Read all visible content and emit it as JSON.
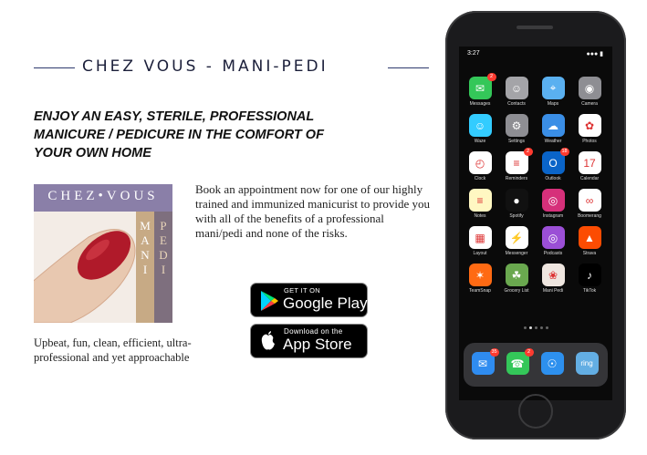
{
  "header": {
    "title": "CHEZ VOUS - MANI-PEDI"
  },
  "headline": "ENJOY AN EASY, STERILE, PROFESSIONAL MANICURE  / PEDICURE IN THE COMFORT OF YOUR OWN HOME",
  "description": "Book an appointment now for one of our highly trained and immunized manicurist to provide you with all of the benefits of a professional mani/pedi and none of the risks.",
  "tagline": "Upbeat, fun, clean, efficient, ultra-professional and yet approachable",
  "logo": {
    "top": "CHEZ•VOUS",
    "mani": [
      "M",
      "A",
      "N",
      "I"
    ],
    "pedi": [
      "P",
      "E",
      "D",
      "I"
    ]
  },
  "stores": {
    "google": {
      "small": "GET IT ON",
      "big": "Google Play"
    },
    "apple": {
      "small": "Download on the",
      "big": "App Store"
    }
  },
  "phone": {
    "time": "3:27",
    "apps": [
      {
        "label": "Messages",
        "color": "#34c759",
        "glyph": "✉",
        "badge": "2"
      },
      {
        "label": "Contacts",
        "color": "#a4a4a8",
        "glyph": "☺",
        "badge": ""
      },
      {
        "label": "Maps",
        "color": "#5ab0f0",
        "glyph": "⌖",
        "badge": ""
      },
      {
        "label": "Camera",
        "color": "#8e8e93",
        "glyph": "◉",
        "badge": ""
      },
      {
        "label": "Waze",
        "color": "#33ccff",
        "glyph": "☺",
        "badge": ""
      },
      {
        "label": "Settings",
        "color": "#8e8e93",
        "glyph": "⚙",
        "badge": ""
      },
      {
        "label": "Weather",
        "color": "#3a8ee6",
        "glyph": "☁",
        "badge": ""
      },
      {
        "label": "Photos",
        "color": "#ffffff",
        "glyph": "✿",
        "badge": ""
      },
      {
        "label": "Clock",
        "color": "#ffffff",
        "glyph": "◴",
        "badge": ""
      },
      {
        "label": "Reminders",
        "color": "#ffffff",
        "glyph": "≡",
        "badge": "2"
      },
      {
        "label": "Outlook",
        "color": "#0a64c8",
        "glyph": "O",
        "badge": "18"
      },
      {
        "label": "Calendar",
        "color": "#ffffff",
        "glyph": "17",
        "badge": ""
      },
      {
        "label": "Notes",
        "color": "#fff7c2",
        "glyph": "≡",
        "badge": ""
      },
      {
        "label": "Spotify",
        "color": "#111111",
        "glyph": "●",
        "badge": ""
      },
      {
        "label": "Instagram",
        "color": "#d6307a",
        "glyph": "◎",
        "badge": ""
      },
      {
        "label": "Boomerang",
        "color": "#ffffff",
        "glyph": "∞",
        "badge": ""
      },
      {
        "label": "Layout",
        "color": "#ffffff",
        "glyph": "▦",
        "badge": ""
      },
      {
        "label": "Messenger",
        "color": "#ffffff",
        "glyph": "⚡",
        "badge": ""
      },
      {
        "label": "Podcasts",
        "color": "#9b4fd6",
        "glyph": "◎",
        "badge": ""
      },
      {
        "label": "Strava",
        "color": "#fc4c02",
        "glyph": "▲",
        "badge": ""
      },
      {
        "label": "TeamSnap",
        "color": "#ff6a13",
        "glyph": "✶",
        "badge": ""
      },
      {
        "label": "Grocery List",
        "color": "#6aa84f",
        "glyph": "☘",
        "badge": ""
      },
      {
        "label": "Mani Pedi",
        "color": "#efe6e0",
        "glyph": "❀",
        "badge": ""
      },
      {
        "label": "TikTok",
        "color": "#000000",
        "glyph": "♪",
        "badge": ""
      }
    ],
    "dock": [
      {
        "label": "",
        "color": "#2f8cf0",
        "glyph": "✉",
        "badge": "35"
      },
      {
        "label": "",
        "color": "#34c759",
        "glyph": "☎",
        "badge": "2"
      },
      {
        "label": "",
        "color": "#2d90ee",
        "glyph": "☉",
        "badge": ""
      },
      {
        "label": "",
        "color": "#63aee3",
        "glyph": "ring",
        "badge": ""
      }
    ]
  }
}
